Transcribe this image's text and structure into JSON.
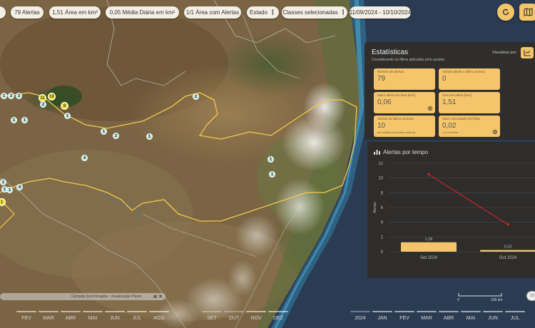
{
  "filters": {
    "alerts": "79 Alertas",
    "area_total": "1,51 Área em km²",
    "daily_avg": "0,05 Média Diária em km²",
    "area_with_alerts": "1/1 Área com Alertas",
    "state": "Estado",
    "classes": "Classes selecionadas",
    "date_range": "11/09/2024 - 10/10/2024"
  },
  "markers": [
    {
      "label": "1"
    },
    {
      "label": "3"
    },
    {
      "label": "3"
    },
    {
      "label": "11"
    },
    {
      "label": "10"
    },
    {
      "label": "2"
    },
    {
      "label": "8"
    },
    {
      "label": "1"
    },
    {
      "label": "1"
    },
    {
      "label": "1"
    },
    {
      "label": "1"
    },
    {
      "label": "2"
    },
    {
      "label": "1"
    },
    {
      "label": "2"
    },
    {
      "label": "4"
    },
    {
      "label": "1"
    },
    {
      "label": "1"
    },
    {
      "label": "1"
    },
    {
      "label": "1"
    },
    {
      "label": "4"
    },
    {
      "label": "1"
    },
    {
      "label": "1"
    }
  ],
  "stats": {
    "title": "Estatísticas",
    "subtitle": "Considerando os filtros aplicados pelo usuário",
    "view_label": "Visualizar por:",
    "cards": [
      {
        "label": "Número de alertas",
        "value": "79",
        "sub": ""
      },
      {
        "label": "Alertas desde o último acesso",
        "value": "0",
        "sub": ""
      },
      {
        "label": "Maior alerta em área (km²)",
        "value": "0,06",
        "sub": ""
      },
      {
        "label": "Área em alerta (km²)",
        "value": "1,51",
        "sub": ""
      },
      {
        "label": "Alertas da última semana",
        "value": "10",
        "sub": "em relação à semana anterior"
      },
      {
        "label": "Maior velocidade (km²/dia)",
        "value": "0,02",
        "sub": "0,11 km²/dia"
      }
    ]
  },
  "chart_panel": {
    "title": "Alertas por tempo"
  },
  "chart_data": {
    "type": "bar",
    "title": "Alertas por tempo",
    "categories": [
      "Set 2024",
      "Out 2024"
    ],
    "series": [
      {
        "values": [
          1.28,
          0.23
        ],
        "type": "bar",
        "data_labels": [
          "1,28",
          "0,23"
        ],
        "color": "#f4c56a"
      },
      {
        "values": [
          10.5,
          3.7
        ],
        "type": "line",
        "color": "#e02424"
      }
    ],
    "ylabel": "Alertas",
    "yticks": [
      "0",
      "2",
      "4",
      "6",
      "8",
      "10",
      "12"
    ],
    "ylim": [
      0,
      12
    ],
    "grid": true
  },
  "source": {
    "text": "Camada Sono/Imageia - visualização Planet"
  },
  "scale": {
    "start": "0",
    "end": "100 km"
  },
  "timeline": {
    "months_left": [
      "FEV",
      "MAR",
      "ABR",
      "MAI",
      "JUN",
      "JUL",
      "AGO",
      "SET",
      "OUT",
      "NOV",
      "DEZ"
    ],
    "year": "2024",
    "months_right": [
      "JAN",
      "FEV",
      "MAR",
      "ABR",
      "MAI",
      "JUN",
      "JUL"
    ]
  },
  "toggle_label": "2D",
  "colors": {
    "accent": "#f4c56a",
    "panel": "#2f2e2d",
    "line": "#e02424",
    "marker": "#bfe9df",
    "marker_highlight": "#f5e43a",
    "boundary": "#f2c94c"
  }
}
